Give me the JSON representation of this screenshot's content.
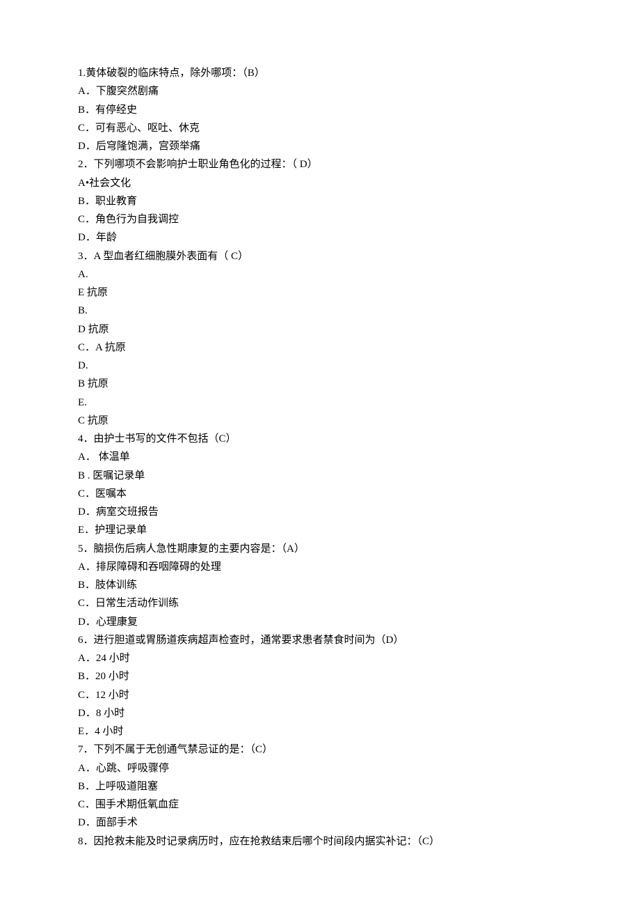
{
  "lines": [
    "1.黄体破裂的临床特点，除外哪项：（B）",
    "A．下腹突然剧痛",
    "B．有停经史",
    "C．可有恶心、呕吐、休克",
    "D．后穹隆饱满，宫颈举痛",
    "2．下列哪项不会影响护士职业角色化的过程：（ D）",
    "A•社会文化",
    "B．职业教育",
    "C．角色行为自我调控",
    "D．年龄",
    "3．A 型血者红细胞膜外表面有（ C）",
    "A.",
    "E 抗原",
    "B.",
    "D 抗原",
    "C．A 抗原",
    "D.",
    "B 抗原",
    "E.",
    "C 抗原",
    "4．由护士书写的文件不包括（C）",
    "A． 体温单",
    "B . 医嘱记录单",
    "C．医嘱本",
    "D．病室交班报告",
    "E．护理记录单",
    "5．脑损伤后病人急性期康复的主要内容是：（A）",
    "A．排尿障碍和吞咽障碍的处理",
    "B．肢体训练",
    "C．日常生活动作训练",
    "D．心理康复",
    "6．进行胆道或胃肠道疾病超声检查时，通常要求患者禁食时间为（D）",
    "A．24 小时",
    "B．20 小时",
    "C．12 小时",
    "D．8 小时",
    "E．4 小时",
    "7．下列不属于无创通气禁忌证的是：（C）",
    "A．心跳、呼吸骤停",
    "B．上呼吸道阻塞",
    "C．围手术期低氧血症",
    "D．面部手术",
    "8．因抢救未能及时记录病历时，应在抢救结束后哪个时间段内据实补记：（C）"
  ]
}
